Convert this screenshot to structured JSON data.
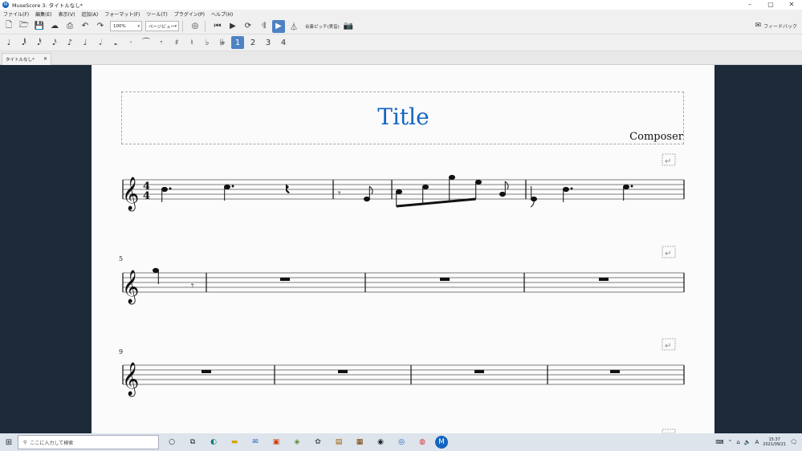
{
  "window": {
    "title": "MuseScore 3: タイトルなし*",
    "minimize": "–",
    "maximize": "▢",
    "close": "✕"
  },
  "menu": [
    "ファイル(F)",
    "編集(E)",
    "表示(V)",
    "追加(A)",
    "フォーマット(F)",
    "ツール(T)",
    "プラグイン(P)",
    "ヘルプ(H)"
  ],
  "toolbar": {
    "zoom": "100%",
    "view_mode": "ページビュー",
    "concert_pitch": "合奏ピッチ(実音)",
    "feedback": "フィードバック"
  },
  "tab": {
    "label": "タイトルなし*",
    "close": "✕"
  },
  "score": {
    "title": "Title",
    "composer": "Composer",
    "measure_numbers": [
      "5",
      "9"
    ]
  },
  "taskbar": {
    "search_placeholder": "ここに入力して検索",
    "time": "15:37",
    "date": "2021/09/21",
    "ime": "A"
  },
  "colors": {
    "accent": "#1565c0",
    "score_background": "#1c2a3a",
    "page": "#fbfbfb"
  }
}
